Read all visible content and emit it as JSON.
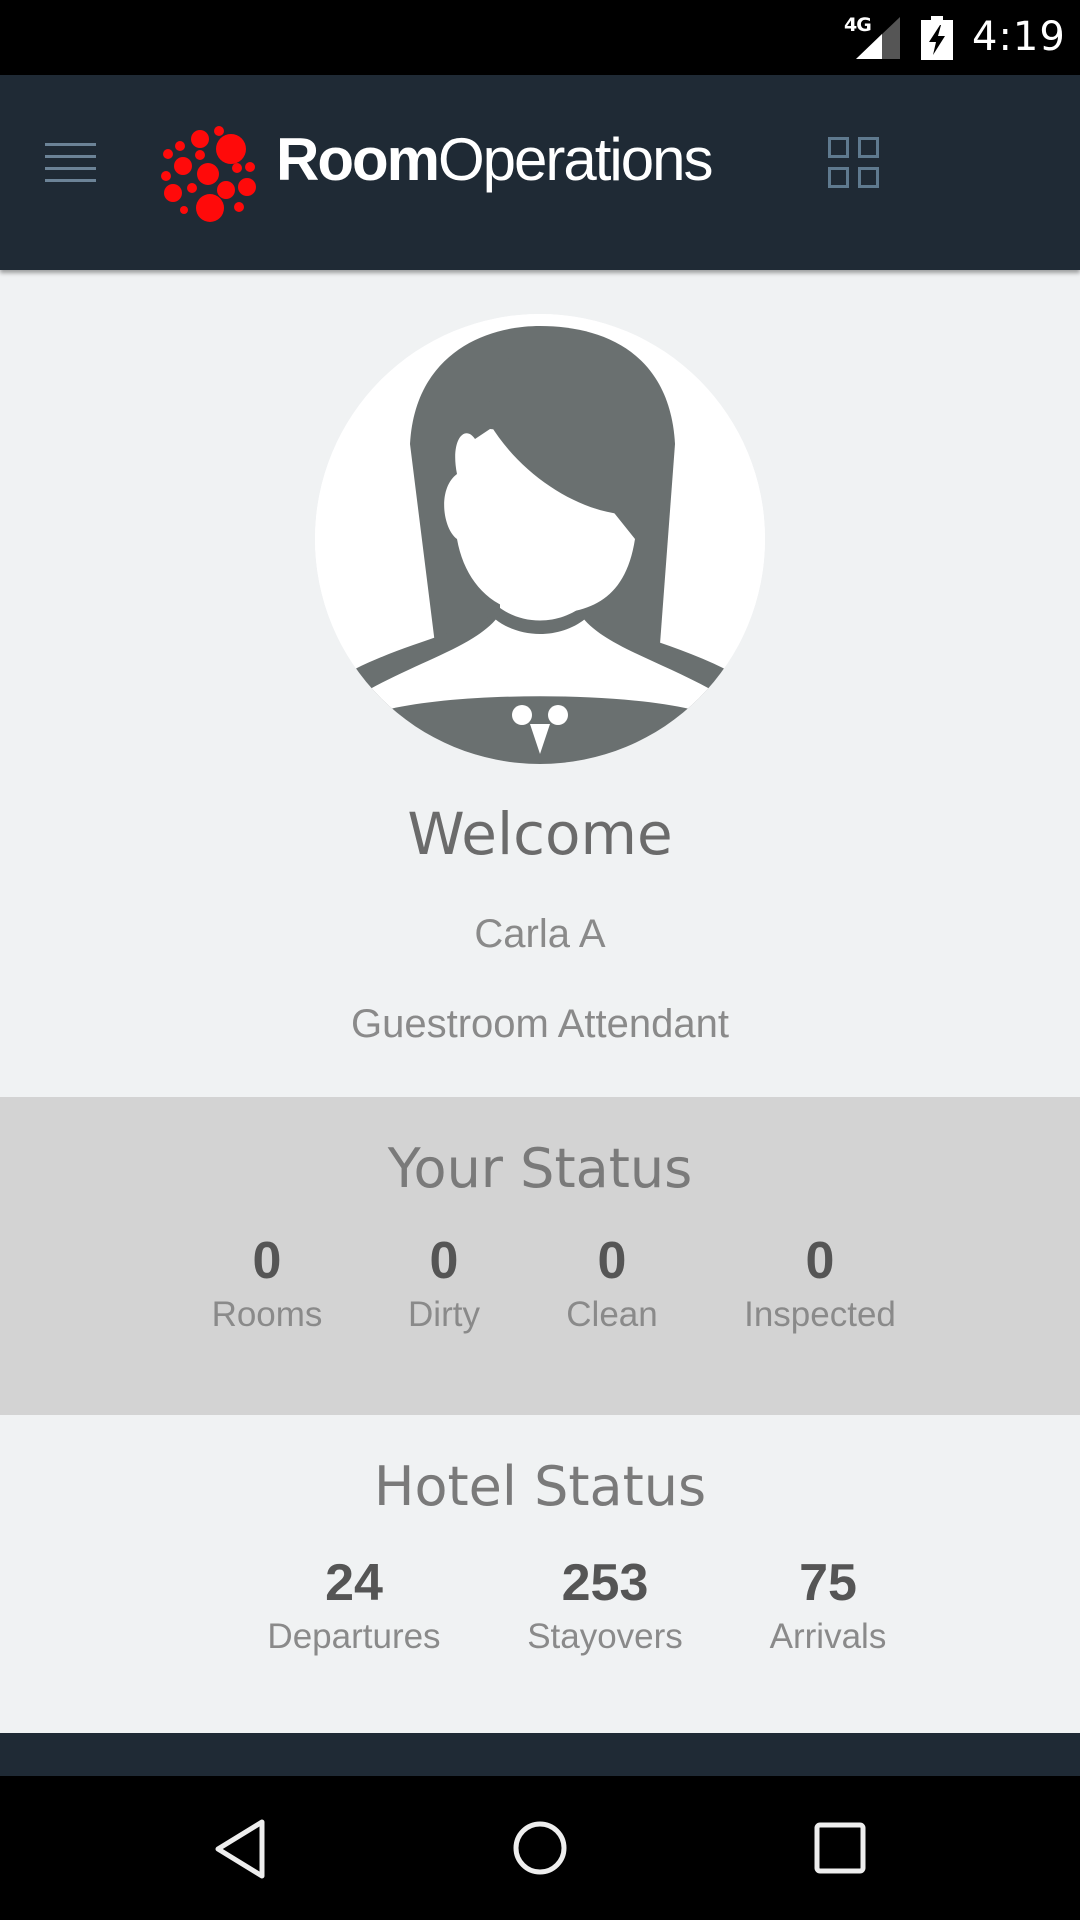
{
  "status_bar": {
    "network": "4G",
    "time": "4:19",
    "icons": [
      "signal-icon",
      "battery-charging-icon"
    ]
  },
  "header": {
    "brand_bold": "Room",
    "brand_light": "Operations",
    "brand_color": "#ff0000",
    "background": "#1f2a35",
    "icons": [
      "menu-icon",
      "logo-icon",
      "grid-icon"
    ]
  },
  "welcome": {
    "title": "Welcome",
    "name": "Carla A",
    "role": "Guestroom Attendant",
    "avatar": "female-avatar-icon"
  },
  "your_status": {
    "title": "Your Status",
    "stats": [
      {
        "value": "0",
        "label": "Rooms"
      },
      {
        "value": "0",
        "label": "Dirty"
      },
      {
        "value": "0",
        "label": "Clean"
      },
      {
        "value": "0",
        "label": "Inspected"
      }
    ]
  },
  "hotel_status": {
    "title": "Hotel Status",
    "stats": [
      {
        "value": "24",
        "label": "Departures"
      },
      {
        "value": "253",
        "label": "Stayovers"
      },
      {
        "value": "75",
        "label": "Arrivals"
      }
    ]
  },
  "nav_bar": {
    "icons": [
      "back-icon",
      "home-icon",
      "recents-icon"
    ]
  }
}
